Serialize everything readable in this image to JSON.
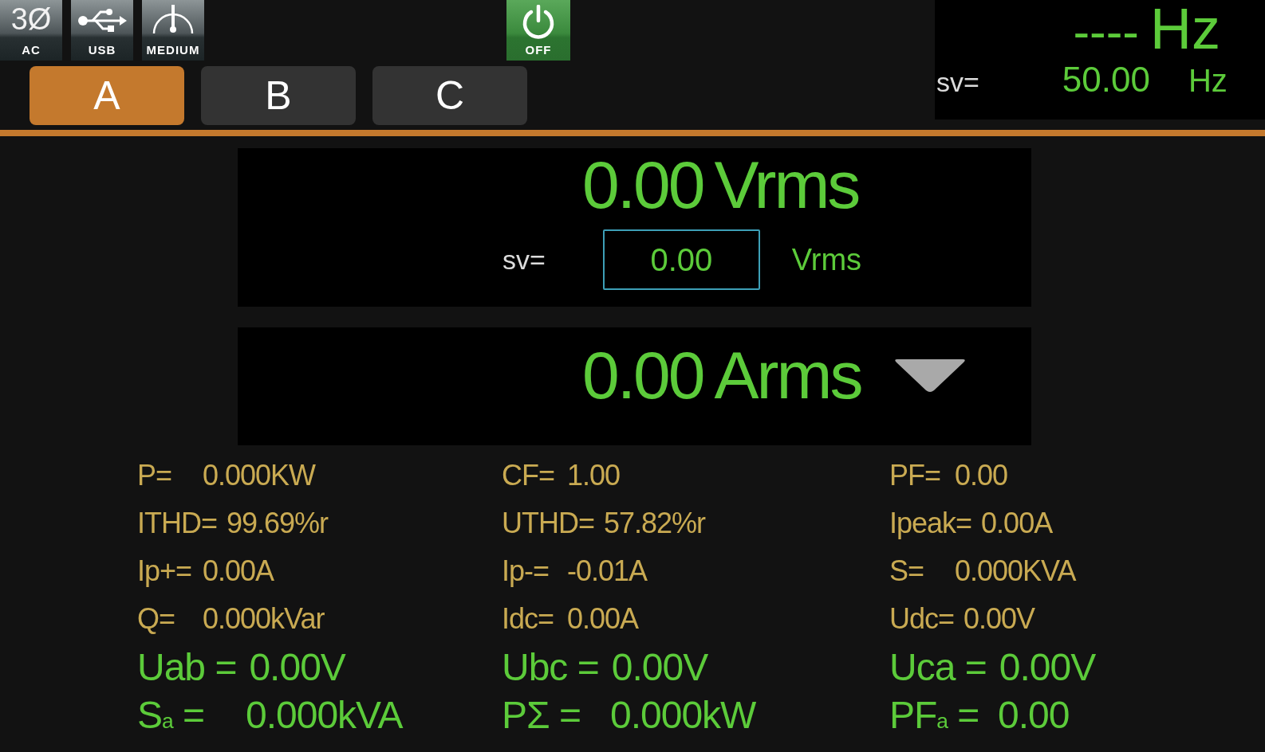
{
  "status_icons": [
    {
      "kind": "phase",
      "symbol": "3Ø",
      "label": "AC"
    },
    {
      "kind": "usb",
      "label": "USB"
    },
    {
      "kind": "gauge",
      "label": "MEDIUM"
    }
  ],
  "output_button": {
    "label": "OFF"
  },
  "phase_tabs": [
    {
      "label": "A",
      "selected": true
    },
    {
      "label": "B",
      "selected": false
    },
    {
      "label": "C",
      "selected": false
    }
  ],
  "frequency": {
    "reading": "----",
    "unit": "Hz",
    "sv_label": "sv=",
    "sv_value": "50.00",
    "sv_unit": "Hz"
  },
  "voltage": {
    "reading": "0.00",
    "unit": "Vrms",
    "sv_label": "sv=",
    "sv_value": "0.00",
    "sv_unit": "Vrms"
  },
  "current": {
    "reading": "0.00",
    "unit": "Arms"
  },
  "measurements": [
    {
      "kind": "detail",
      "label": "P=",
      "value": "0.000KW"
    },
    {
      "kind": "detail",
      "label": "CF=",
      "value": "1.00"
    },
    {
      "kind": "detail",
      "label": "PF=",
      "value": "0.00"
    },
    {
      "kind": "detail",
      "label": "ITHD=",
      "value": "99.69%r"
    },
    {
      "kind": "detail",
      "label": "UTHD=",
      "value": "57.82%r"
    },
    {
      "kind": "detail",
      "label": "Ipeak=",
      "value": "0.00A"
    },
    {
      "kind": "detail",
      "label": "Ip+=",
      "value": "0.00A"
    },
    {
      "kind": "detail",
      "label": "Ip-=",
      "value": "-0.01A"
    },
    {
      "kind": "detail",
      "label": "S=",
      "value": "0.000KVA"
    },
    {
      "kind": "detail",
      "label": "Q=",
      "value": "0.000kVar"
    },
    {
      "kind": "detail",
      "label": "Idc=",
      "value": "0.00A"
    },
    {
      "kind": "detail",
      "label": "Udc=",
      "value": "0.00V"
    },
    {
      "kind": "total",
      "label": "Uab =",
      "value": "0.00V"
    },
    {
      "kind": "total",
      "label": "Ubc =",
      "value": "0.00V"
    },
    {
      "kind": "total",
      "label": "Uca =",
      "value": "0.00V"
    },
    {
      "kind": "total",
      "label": "S$_{a}$ =",
      "value": "0.000kVA"
    },
    {
      "kind": "total",
      "label": "PΣ =",
      "value": "0.000kW"
    },
    {
      "kind": "total",
      "label": "PF$_{a}$ =",
      "value": "0.00"
    }
  ]
}
